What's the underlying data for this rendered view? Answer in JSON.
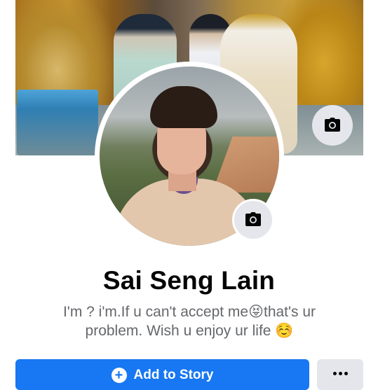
{
  "profile": {
    "name": "Sai Seng Lain",
    "bio_line1": "I'm ? i'm.If u can't accept me😝that's ur",
    "bio_line2": "problem. Wish u enjoy ur life ☺️"
  },
  "actions": {
    "add_story_label": "Add to Story",
    "add_story_icon": "plus-circle-icon",
    "more_icon": "more-dots-icon"
  },
  "icons": {
    "cover_camera": "camera-icon",
    "avatar_camera": "camera-icon"
  },
  "colors": {
    "accent": "#1877f2",
    "text_primary": "#050505",
    "text_secondary": "#65676b",
    "button_gray": "#e4e6eb"
  }
}
